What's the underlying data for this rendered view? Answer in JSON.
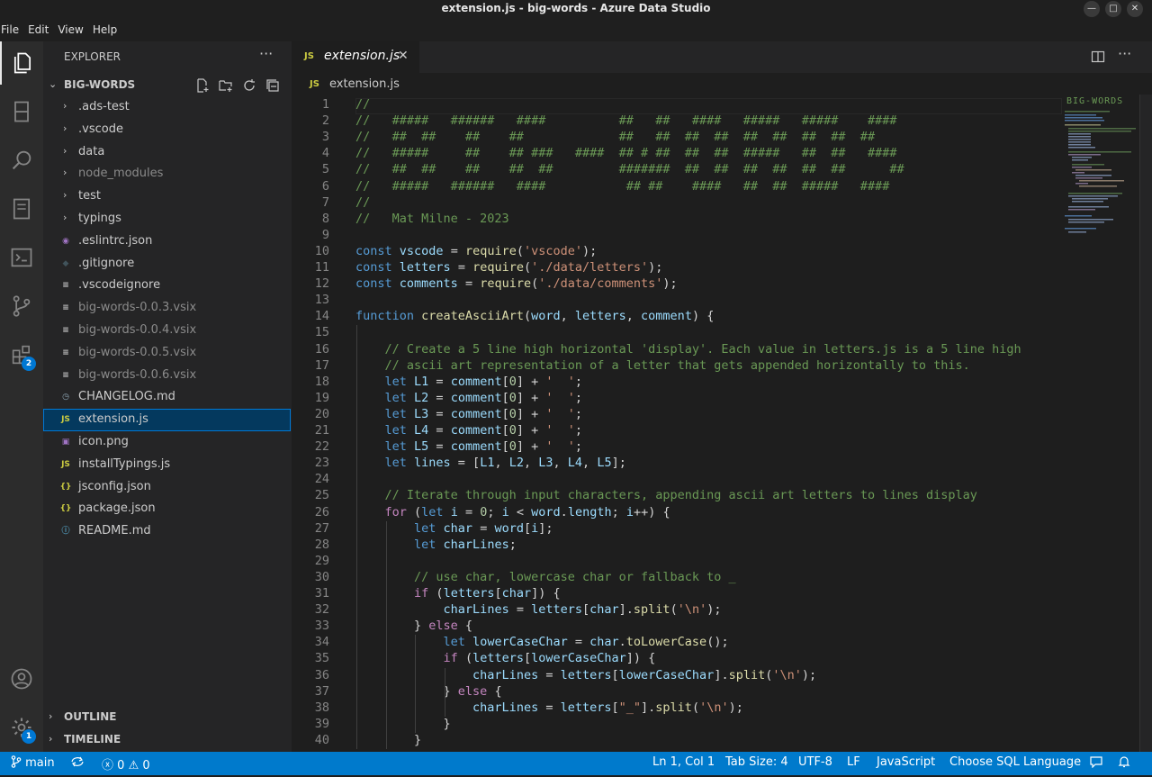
{
  "window": {
    "title": "extension.js - big-words - Azure Data Studio"
  },
  "menu": [
    "File",
    "Edit",
    "View",
    "Help"
  ],
  "activity_bar": {
    "extensions_badge": "2",
    "manage_badge": "1"
  },
  "sidebar": {
    "title": "EXPLORER",
    "more": "···",
    "folder": "BIG-WORDS",
    "items": [
      {
        "label": ".ads-test",
        "type": "folder"
      },
      {
        "label": ".vscode",
        "type": "folder"
      },
      {
        "label": "data",
        "type": "folder"
      },
      {
        "label": "node_modules",
        "type": "folder",
        "dim": true
      },
      {
        "label": "test",
        "type": "folder"
      },
      {
        "label": "typings",
        "type": "folder"
      },
      {
        "label": ".eslintrc.json",
        "type": "eslint"
      },
      {
        "label": ".gitignore",
        "type": "git"
      },
      {
        "label": ".vscodeignore",
        "type": "lines"
      },
      {
        "label": "big-words-0.0.3.vsix",
        "type": "lines",
        "dim": true
      },
      {
        "label": "big-words-0.0.4.vsix",
        "type": "lines",
        "dim": true
      },
      {
        "label": "big-words-0.0.5.vsix",
        "type": "lines",
        "dim": true
      },
      {
        "label": "big-words-0.0.6.vsix",
        "type": "lines",
        "dim": true
      },
      {
        "label": "CHANGELOG.md",
        "type": "changelog"
      },
      {
        "label": "extension.js",
        "type": "js",
        "selected": true
      },
      {
        "label": "icon.png",
        "type": "image"
      },
      {
        "label": "installTypings.js",
        "type": "js"
      },
      {
        "label": "jsconfig.json",
        "type": "json"
      },
      {
        "label": "package.json",
        "type": "json"
      },
      {
        "label": "README.md",
        "type": "info"
      }
    ],
    "outline": "OUTLINE",
    "timeline": "TIMELINE"
  },
  "tab": {
    "icon": "JS",
    "label": "extension.js",
    "close": "✕"
  },
  "breadcrumb": {
    "icon": "JS",
    "file": "extension.js"
  },
  "editor": {
    "lines": [
      [
        [
          "c",
          "//"
        ]
      ],
      [
        [
          "c",
          "//   #####   ######   ####          ##   ##   ####   #####   #####    ####"
        ]
      ],
      [
        [
          "c",
          "//   ##  ##    ##    ##             ##   ##  ##  ##  ##  ##  ##  ##  ##"
        ]
      ],
      [
        [
          "c",
          "//   #####     ##    ## ###   ####  ## # ##  ##  ##  #####   ##  ##   ####"
        ]
      ],
      [
        [
          "c",
          "//   ##  ##    ##    ##  ##         #######  ##  ##  ##  ##  ##  ##      ##"
        ]
      ],
      [
        [
          "c",
          "//   #####   ######   ####           ## ##    ####   ##  ##  #####   ####"
        ]
      ],
      [
        [
          "c",
          "//"
        ]
      ],
      [
        [
          "c",
          "//   Mat Milne - 2023"
        ]
      ],
      [],
      [
        [
          "k",
          "const "
        ],
        [
          "v",
          "vscode"
        ],
        [
          "p",
          " = "
        ],
        [
          "f",
          "require"
        ],
        [
          "p",
          "("
        ],
        [
          "s",
          "'vscode'"
        ],
        [
          "p",
          ");"
        ]
      ],
      [
        [
          "k",
          "const "
        ],
        [
          "v",
          "letters"
        ],
        [
          "p",
          " = "
        ],
        [
          "f",
          "require"
        ],
        [
          "p",
          "("
        ],
        [
          "s",
          "'./data/letters'"
        ],
        [
          "p",
          ");"
        ]
      ],
      [
        [
          "k",
          "const "
        ],
        [
          "v",
          "comments"
        ],
        [
          "p",
          " = "
        ],
        [
          "f",
          "require"
        ],
        [
          "p",
          "("
        ],
        [
          "s",
          "'./data/comments'"
        ],
        [
          "p",
          ");"
        ]
      ],
      [],
      [
        [
          "k",
          "function "
        ],
        [
          "f",
          "createAsciiArt"
        ],
        [
          "p",
          "("
        ],
        [
          "v",
          "word"
        ],
        [
          "p",
          ", "
        ],
        [
          "v",
          "letters"
        ],
        [
          "p",
          ", "
        ],
        [
          "v",
          "comment"
        ],
        [
          "p",
          ") {"
        ]
      ],
      [],
      [
        [
          "p",
          "    "
        ],
        [
          "c",
          "// Create a 5 line high horizontal 'display'. Each value in letters.js is a 5 line high"
        ]
      ],
      [
        [
          "p",
          "    "
        ],
        [
          "c",
          "// ascii art representation of a letter that gets appended horizontally to this."
        ]
      ],
      [
        [
          "p",
          "    "
        ],
        [
          "k",
          "let "
        ],
        [
          "v",
          "L1"
        ],
        [
          "p",
          " = "
        ],
        [
          "v",
          "comment"
        ],
        [
          "p",
          "["
        ],
        [
          "n",
          "0"
        ],
        [
          "p",
          "] + "
        ],
        [
          "s",
          "'  '"
        ],
        [
          "p",
          ";"
        ]
      ],
      [
        [
          "p",
          "    "
        ],
        [
          "k",
          "let "
        ],
        [
          "v",
          "L2"
        ],
        [
          "p",
          " = "
        ],
        [
          "v",
          "comment"
        ],
        [
          "p",
          "["
        ],
        [
          "n",
          "0"
        ],
        [
          "p",
          "] + "
        ],
        [
          "s",
          "'  '"
        ],
        [
          "p",
          ";"
        ]
      ],
      [
        [
          "p",
          "    "
        ],
        [
          "k",
          "let "
        ],
        [
          "v",
          "L3"
        ],
        [
          "p",
          " = "
        ],
        [
          "v",
          "comment"
        ],
        [
          "p",
          "["
        ],
        [
          "n",
          "0"
        ],
        [
          "p",
          "] + "
        ],
        [
          "s",
          "'  '"
        ],
        [
          "p",
          ";"
        ]
      ],
      [
        [
          "p",
          "    "
        ],
        [
          "k",
          "let "
        ],
        [
          "v",
          "L4"
        ],
        [
          "p",
          " = "
        ],
        [
          "v",
          "comment"
        ],
        [
          "p",
          "["
        ],
        [
          "n",
          "0"
        ],
        [
          "p",
          "] + "
        ],
        [
          "s",
          "'  '"
        ],
        [
          "p",
          ";"
        ]
      ],
      [
        [
          "p",
          "    "
        ],
        [
          "k",
          "let "
        ],
        [
          "v",
          "L5"
        ],
        [
          "p",
          " = "
        ],
        [
          "v",
          "comment"
        ],
        [
          "p",
          "["
        ],
        [
          "n",
          "0"
        ],
        [
          "p",
          "] + "
        ],
        [
          "s",
          "'  '"
        ],
        [
          "p",
          ";"
        ]
      ],
      [
        [
          "p",
          "    "
        ],
        [
          "k",
          "let "
        ],
        [
          "v",
          "lines"
        ],
        [
          "p",
          " = ["
        ],
        [
          "v",
          "L1"
        ],
        [
          "p",
          ", "
        ],
        [
          "v",
          "L2"
        ],
        [
          "p",
          ", "
        ],
        [
          "v",
          "L3"
        ],
        [
          "p",
          ", "
        ],
        [
          "v",
          "L4"
        ],
        [
          "p",
          ", "
        ],
        [
          "v",
          "L5"
        ],
        [
          "p",
          "];"
        ]
      ],
      [],
      [
        [
          "p",
          "    "
        ],
        [
          "c",
          "// Iterate through input characters, appending ascii art letters to lines display"
        ]
      ],
      [
        [
          "p",
          "    "
        ],
        [
          "cf",
          "for"
        ],
        [
          "p",
          " ("
        ],
        [
          "k",
          "let "
        ],
        [
          "v",
          "i"
        ],
        [
          "p",
          " = "
        ],
        [
          "n",
          "0"
        ],
        [
          "p",
          "; "
        ],
        [
          "v",
          "i"
        ],
        [
          "p",
          " < "
        ],
        [
          "v",
          "word"
        ],
        [
          "p",
          "."
        ],
        [
          "v",
          "length"
        ],
        [
          "p",
          "; "
        ],
        [
          "v",
          "i"
        ],
        [
          "p",
          "++) {"
        ]
      ],
      [
        [
          "p",
          "        "
        ],
        [
          "k",
          "let "
        ],
        [
          "v",
          "char"
        ],
        [
          "p",
          " = "
        ],
        [
          "v",
          "word"
        ],
        [
          "p",
          "["
        ],
        [
          "v",
          "i"
        ],
        [
          "p",
          "];"
        ]
      ],
      [
        [
          "p",
          "        "
        ],
        [
          "k",
          "let "
        ],
        [
          "v",
          "charLines"
        ],
        [
          "p",
          ";"
        ]
      ],
      [],
      [
        [
          "p",
          "        "
        ],
        [
          "c",
          "// use char, lowercase char or fallback to _"
        ]
      ],
      [
        [
          "p",
          "        "
        ],
        [
          "cf",
          "if"
        ],
        [
          "p",
          " ("
        ],
        [
          "v",
          "letters"
        ],
        [
          "p",
          "["
        ],
        [
          "v",
          "char"
        ],
        [
          "p",
          "]) {"
        ]
      ],
      [
        [
          "p",
          "            "
        ],
        [
          "v",
          "charLines"
        ],
        [
          "p",
          " = "
        ],
        [
          "v",
          "letters"
        ],
        [
          "p",
          "["
        ],
        [
          "v",
          "char"
        ],
        [
          "p",
          "]."
        ],
        [
          "f",
          "split"
        ],
        [
          "p",
          "("
        ],
        [
          "s",
          "'\\n'"
        ],
        [
          "p",
          ");"
        ]
      ],
      [
        [
          "p",
          "        } "
        ],
        [
          "cf",
          "else"
        ],
        [
          "p",
          " {"
        ]
      ],
      [
        [
          "p",
          "            "
        ],
        [
          "k",
          "let "
        ],
        [
          "v",
          "lowerCaseChar"
        ],
        [
          "p",
          " = "
        ],
        [
          "v",
          "char"
        ],
        [
          "p",
          "."
        ],
        [
          "f",
          "toLowerCase"
        ],
        [
          "p",
          "();"
        ]
      ],
      [
        [
          "p",
          "            "
        ],
        [
          "cf",
          "if"
        ],
        [
          "p",
          " ("
        ],
        [
          "v",
          "letters"
        ],
        [
          "p",
          "["
        ],
        [
          "v",
          "lowerCaseChar"
        ],
        [
          "p",
          "]) {"
        ]
      ],
      [
        [
          "p",
          "                "
        ],
        [
          "v",
          "charLines"
        ],
        [
          "p",
          " = "
        ],
        [
          "v",
          "letters"
        ],
        [
          "p",
          "["
        ],
        [
          "v",
          "lowerCaseChar"
        ],
        [
          "p",
          "]."
        ],
        [
          "f",
          "split"
        ],
        [
          "p",
          "("
        ],
        [
          "s",
          "'\\n'"
        ],
        [
          "p",
          ");"
        ]
      ],
      [
        [
          "p",
          "            } "
        ],
        [
          "cf",
          "else"
        ],
        [
          "p",
          " {"
        ]
      ],
      [
        [
          "p",
          "                "
        ],
        [
          "v",
          "charLines"
        ],
        [
          "p",
          " = "
        ],
        [
          "v",
          "letters"
        ],
        [
          "p",
          "["
        ],
        [
          "s",
          "\"_\""
        ],
        [
          "p",
          "]."
        ],
        [
          "f",
          "split"
        ],
        [
          "p",
          "("
        ],
        [
          "s",
          "'\\n'"
        ],
        [
          "p",
          ");"
        ]
      ],
      [
        [
          "p",
          "            }"
        ]
      ],
      [
        [
          "p",
          "        }"
        ]
      ]
    ]
  },
  "minimap": {
    "title": "BIG-WORDS"
  },
  "statusbar": {
    "branch": "main",
    "errors": "0",
    "warnings": "0",
    "position": "Ln 1, Col 1",
    "tab_size": "Tab Size: 4",
    "encoding": "UTF-8",
    "eol": "LF",
    "language": "JavaScript",
    "sql": "Choose SQL Language"
  }
}
